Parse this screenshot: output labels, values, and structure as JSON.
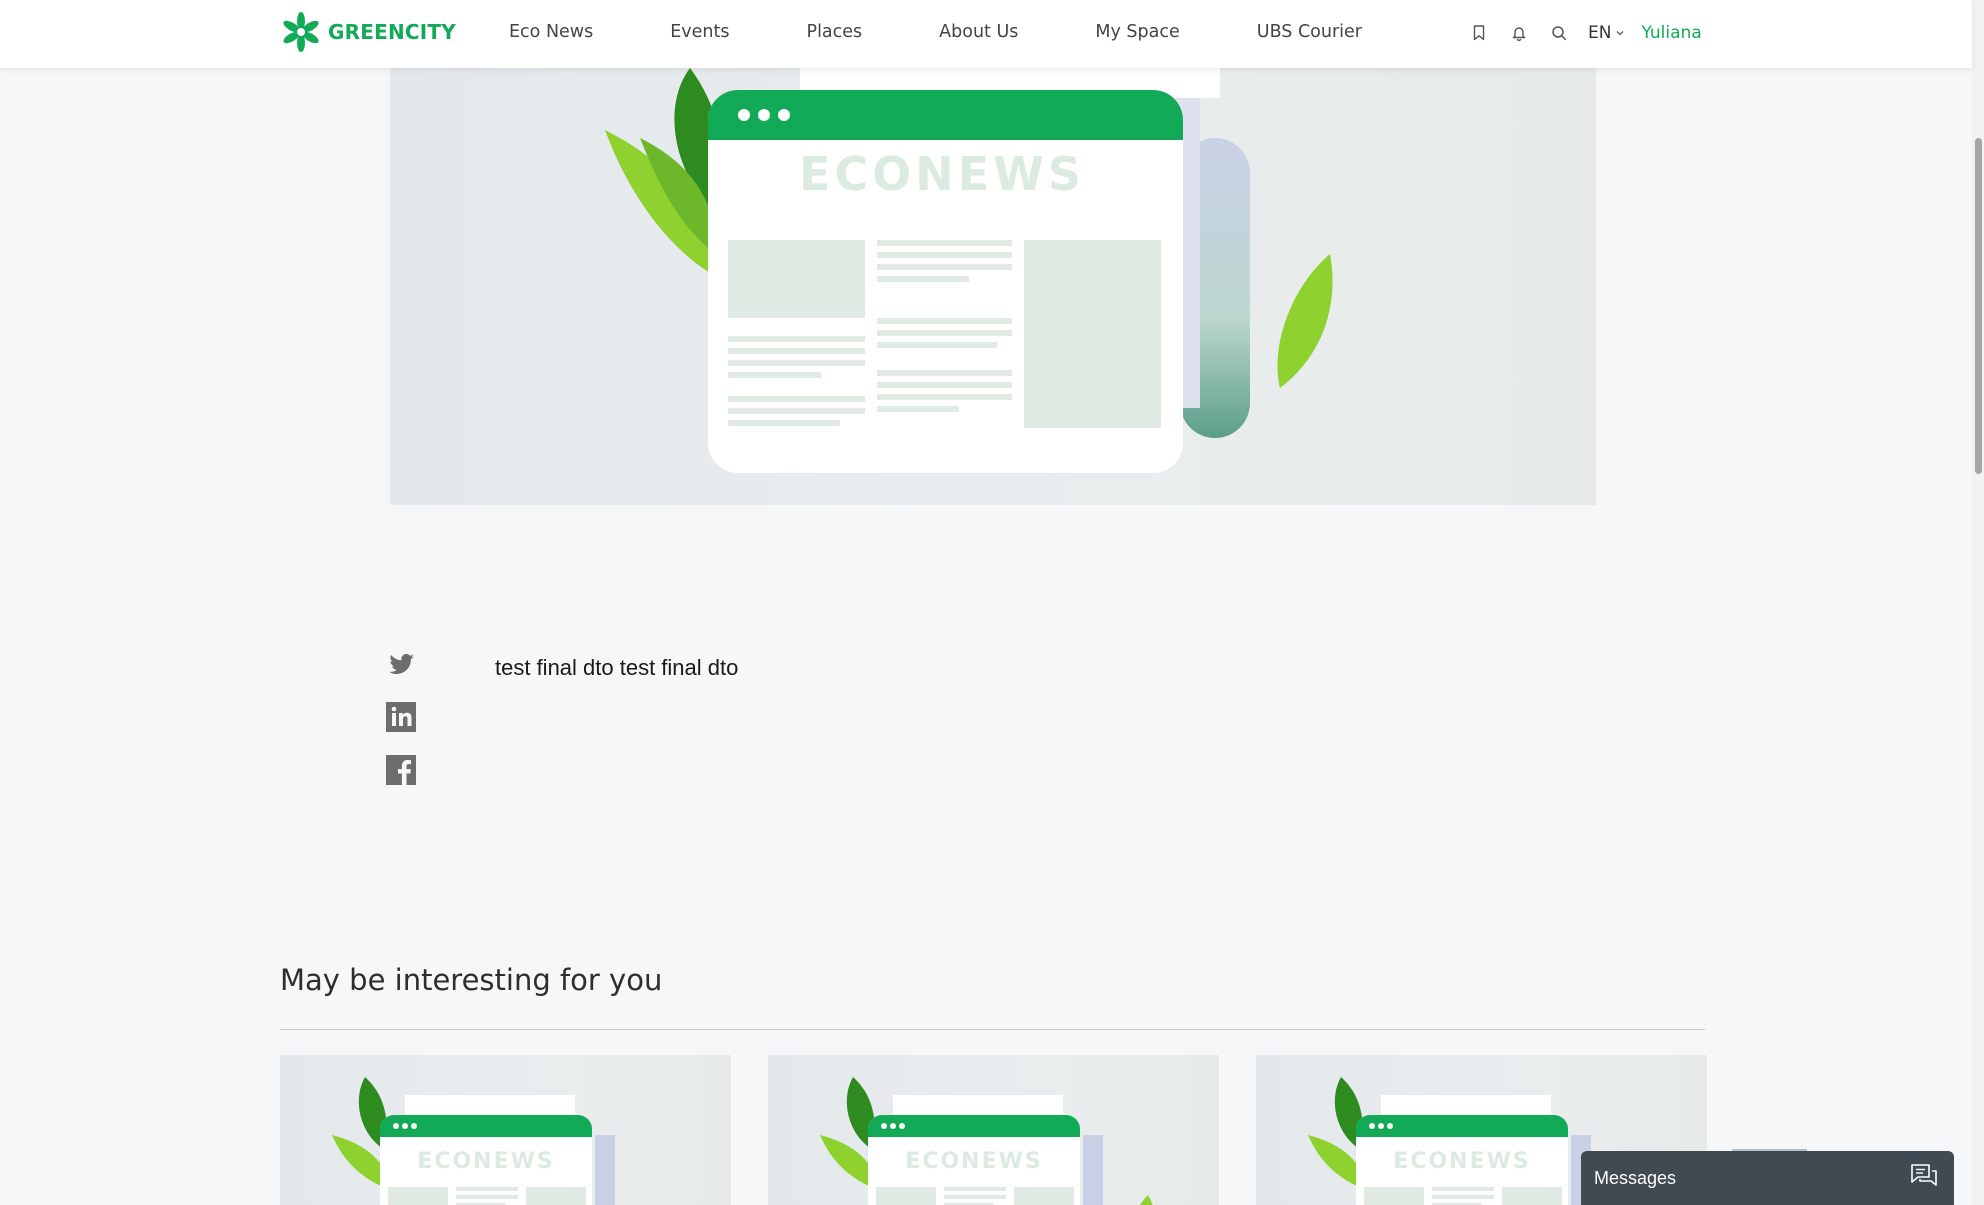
{
  "header": {
    "logo_text": "GREENCITY",
    "nav": [
      {
        "label": "Eco News"
      },
      {
        "label": "Events"
      },
      {
        "label": "Places"
      },
      {
        "label": "About Us"
      },
      {
        "label": "My Space"
      },
      {
        "label": "UBS Courier"
      }
    ],
    "language": "EN",
    "user_name": "Yuliana",
    "icons": [
      "bookmark-icon",
      "bell-icon",
      "search-icon",
      "chevron-down-icon"
    ]
  },
  "hero": {
    "illustration_text": "ECONEWS"
  },
  "article": {
    "body": "test final dto test final dto",
    "share_icons": [
      "twitter-icon",
      "linkedin-icon",
      "facebook-icon"
    ]
  },
  "interesting": {
    "title": "May be interesting for you",
    "cards": [
      {
        "illustration_text": "ECONEWS"
      },
      {
        "illustration_text": "ECONEWS"
      },
      {
        "illustration_text": "ECONEWS"
      }
    ]
  },
  "messages": {
    "label": "Messages"
  },
  "colors": {
    "brand_green": "#13aa57",
    "leaf_light": "#8fd12f",
    "leaf_dark": "#2e8b1f",
    "widget_dark": "#3f4a52"
  }
}
